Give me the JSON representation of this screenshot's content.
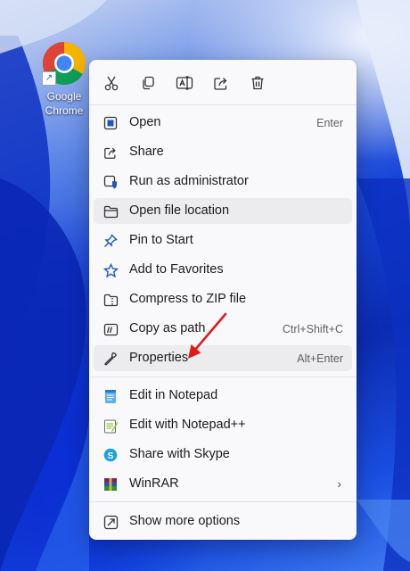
{
  "desktop": {
    "icon_label_line1": "Google",
    "icon_label_line2": "Chrome",
    "icon_name": "google-chrome-icon"
  },
  "toolbar": {
    "cut_icon": "scissors-icon",
    "copy_icon": "copy-icon",
    "rename_icon": "rename-icon",
    "share_icon": "share-icon",
    "delete_icon": "trash-icon"
  },
  "menu": {
    "items": [
      {
        "label": "Open",
        "shortcut": "Enter",
        "icon": "open-window-icon"
      },
      {
        "label": "Share",
        "shortcut": "",
        "icon": "share-icon"
      },
      {
        "label": "Run as administrator",
        "shortcut": "",
        "icon": "admin-shield-icon"
      },
      {
        "label": "Open file location",
        "shortcut": "",
        "icon": "folder-icon"
      },
      {
        "label": "Pin to Start",
        "shortcut": "",
        "icon": "pin-icon"
      },
      {
        "label": "Add to Favorites",
        "shortcut": "",
        "icon": "star-icon"
      },
      {
        "label": "Compress to ZIP file",
        "shortcut": "",
        "icon": "zip-folder-icon"
      },
      {
        "label": "Copy as path",
        "shortcut": "Ctrl+Shift+C",
        "icon": "copy-path-icon"
      },
      {
        "label": "Properties",
        "shortcut": "Alt+Enter",
        "icon": "wrench-icon"
      },
      {
        "label": "Edit in Notepad",
        "shortcut": "",
        "icon": "notepad-icon"
      },
      {
        "label": "Edit with Notepad++",
        "shortcut": "",
        "icon": "notepad-plus-plus-icon"
      },
      {
        "label": "Share with Skype",
        "shortcut": "",
        "icon": "skype-icon"
      },
      {
        "label": "WinRAR",
        "shortcut": "",
        "icon": "winrar-icon",
        "submenu_arrow": "›"
      },
      {
        "label": "Show more options",
        "shortcut": "",
        "icon": "more-options-icon"
      }
    ]
  },
  "colors": {
    "menu_bg": "#f9f9fb",
    "highlight": "#ececef",
    "annotation_arrow": "#e01a1a",
    "accent_blue": "#1a57c4"
  }
}
